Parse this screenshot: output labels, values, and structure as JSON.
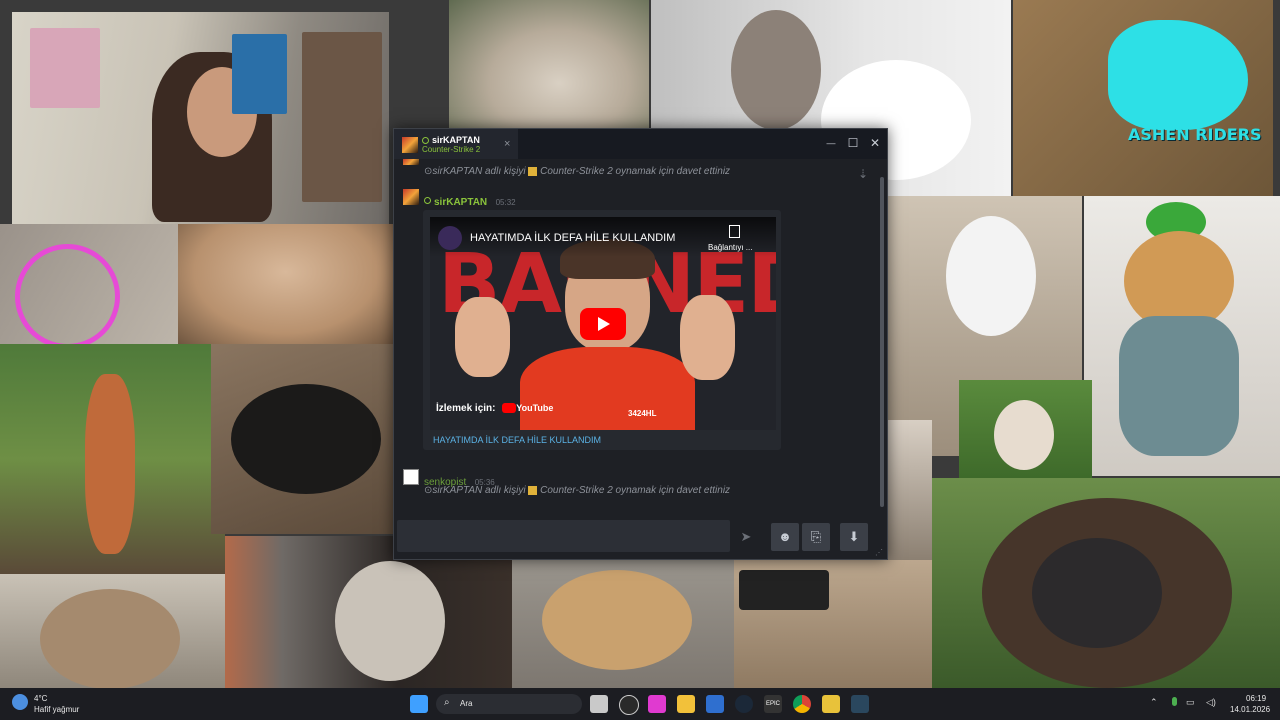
{
  "wallpaper": {
    "logo_text": "ASHEN RIDERS"
  },
  "chat_window": {
    "tab": {
      "user_name": "sirKAPTAN",
      "status_game": "Counter-Strike 2",
      "close_glyph": "×"
    },
    "window_controls": {
      "minimize": "—",
      "maximize": "☐",
      "close": "✕"
    },
    "pin_glyph": "⇣",
    "messages": [
      {
        "type": "system",
        "prefix": "sirKAPTAN adlı kişiyi",
        "game": "Counter-Strike 2",
        "suffix": "oynamak için davet ettiniz"
      },
      {
        "type": "user",
        "author": "sirKAPTAN",
        "time": "05:32",
        "embed": {
          "video_title": "HAYATIMDA İLK DEFA HİLE KULLANDIM",
          "copy_label": "Bağlantıyı ...",
          "banner_text": "BANNED",
          "watch_label": "İzlemek için:",
          "platform": "YouTube",
          "watermark": "3424HL",
          "link_text": "HAYATIMDA İLK DEFA HİLE KULLANDIM"
        }
      },
      {
        "type": "user_system",
        "author": "senkopist",
        "time": "05:36",
        "prefix": "sirKAPTAN adlı kişiyi",
        "game": "Counter-Strike 2",
        "suffix": "oynamak için davet ettiniz"
      }
    ],
    "compose": {
      "placeholder": "",
      "send_glyph": "➤",
      "emoji_glyph": "☻",
      "attach_glyph": "⎘",
      "voice_glyph": "⬇"
    }
  },
  "taskbar": {
    "weather_temp": "4°C",
    "weather_desc": "Hafif yağmur",
    "search_label": "Ara",
    "epic_label": "EPIC",
    "clock_time": "06:19",
    "clock_date": "14.01.2026"
  },
  "colors": {
    "steam_green": "#8ac33b",
    "window_bg": "#1e2025",
    "youtube_red": "#ff0000",
    "taskbar_bg": "#1c1d22"
  }
}
